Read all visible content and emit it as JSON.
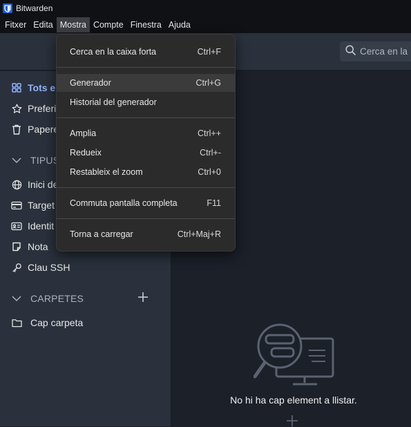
{
  "window": {
    "title": "Bitwarden"
  },
  "menubar": [
    "Fitxer",
    "Edita",
    "Mostra",
    "Compte",
    "Finestra",
    "Ajuda"
  ],
  "search": {
    "placeholder": "Cerca en la"
  },
  "sidebar": {
    "items": [
      {
        "label": "Tots el",
        "icon": "grid-icon"
      },
      {
        "label": "Preferi",
        "icon": "star-icon"
      },
      {
        "label": "Papere",
        "icon": "trash-icon"
      }
    ],
    "types_header": "TIPUS",
    "types": [
      {
        "label": "Inici de",
        "icon": "globe-icon"
      },
      {
        "label": "Target",
        "icon": "card-icon"
      },
      {
        "label": "Identit",
        "icon": "id-card-icon"
      },
      {
        "label": "Nota",
        "icon": "note-icon"
      },
      {
        "label": "Clau SSH",
        "icon": "key-icon"
      }
    ],
    "folders_header": "CARPETES",
    "folders": [
      {
        "label": "Cap carpeta",
        "icon": "folder-icon"
      }
    ]
  },
  "main": {
    "empty_message": "No hi ha cap element a llistar."
  },
  "view_menu": {
    "items": [
      {
        "label": "Cerca en la caixa forta",
        "shortcut": "Ctrl+F"
      },
      {
        "label": "Generador",
        "shortcut": "Ctrl+G"
      },
      {
        "label": "Historial del generador",
        "shortcut": ""
      },
      {
        "label": "Amplia",
        "shortcut": "Ctrl++"
      },
      {
        "label": "Redueix",
        "shortcut": "Ctrl+-"
      },
      {
        "label": "Restableix el zoom",
        "shortcut": "Ctrl+0"
      },
      {
        "label": "Commuta pantalla completa",
        "shortcut": "F11"
      },
      {
        "label": "Torna a carregar",
        "shortcut": "Ctrl+Maj+R"
      }
    ]
  },
  "colors": {
    "accent": "#8fb4ff",
    "brand": "#175ddc",
    "sidebar_bg": "#2a313c",
    "main_bg": "#1b2029",
    "menu_bg": "#2b2b2b"
  }
}
